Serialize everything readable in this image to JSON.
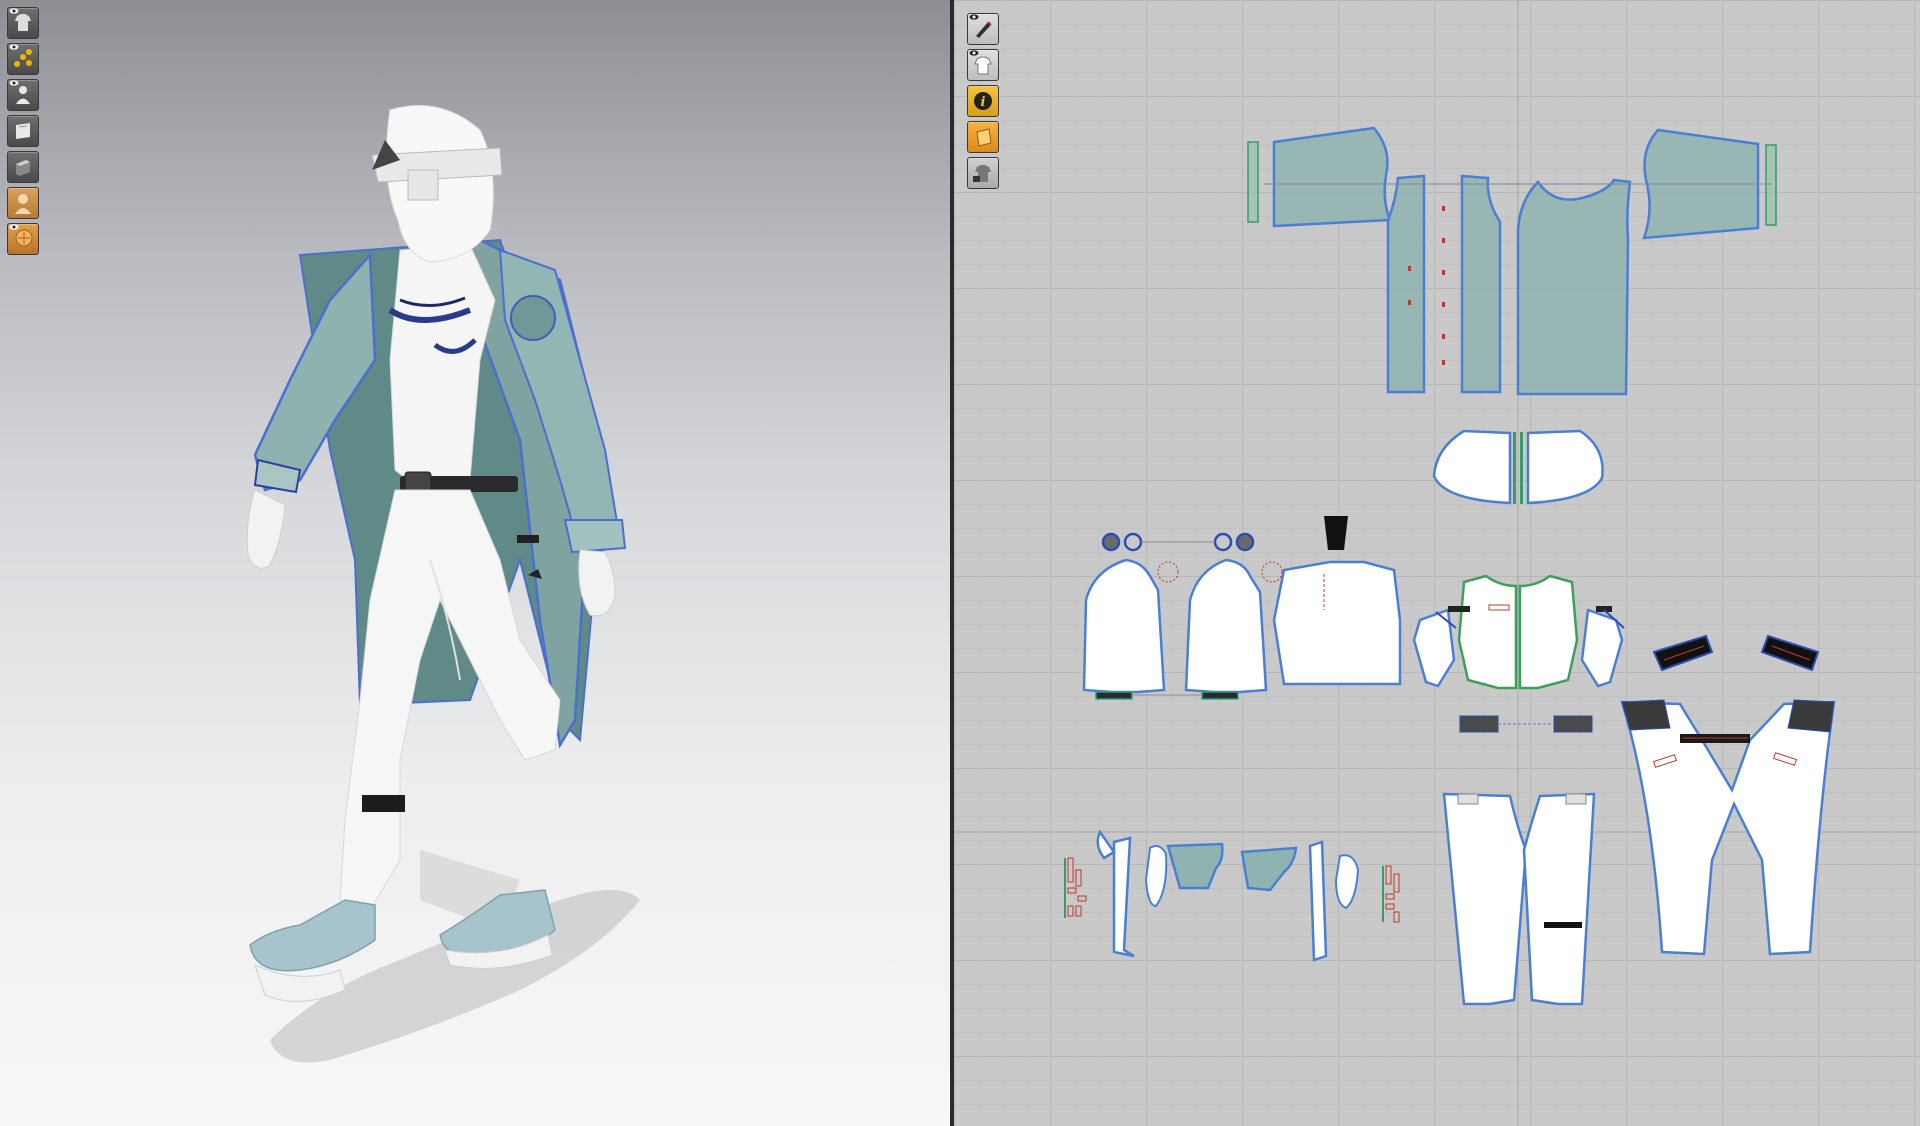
{
  "window": {
    "title": ""
  },
  "viewport3d": {
    "toolbar": [
      {
        "icon": "garment-visibility-icon",
        "active": false
      },
      {
        "icon": "arrangement-points-icon",
        "active": false
      },
      {
        "icon": "avatar-visibility-icon",
        "active": false
      },
      {
        "icon": "fabric-texture-icon",
        "active": false
      },
      {
        "icon": "thickness-render-icon",
        "active": false
      },
      {
        "icon": "avatar-display-icon",
        "active": true
      },
      {
        "icon": "avatar-skin-texture-icon",
        "active": true
      }
    ]
  },
  "viewport2d": {
    "toolbar": [
      {
        "icon": "pattern-edit-icon",
        "active": false
      },
      {
        "icon": "show-garment-2d-icon",
        "active": false
      },
      {
        "icon": "info-icon",
        "active": true
      },
      {
        "icon": "fabric-color-icon",
        "active": true
      },
      {
        "icon": "locked-garment-icon",
        "active": false
      }
    ]
  },
  "colors": {
    "teal_fabric": "#8fb3b0",
    "outline_blue": "#4a7fd4",
    "white_fabric": "#f4f4f4",
    "grid": "#c9c9c9",
    "shoe": "#a6c3cc"
  }
}
